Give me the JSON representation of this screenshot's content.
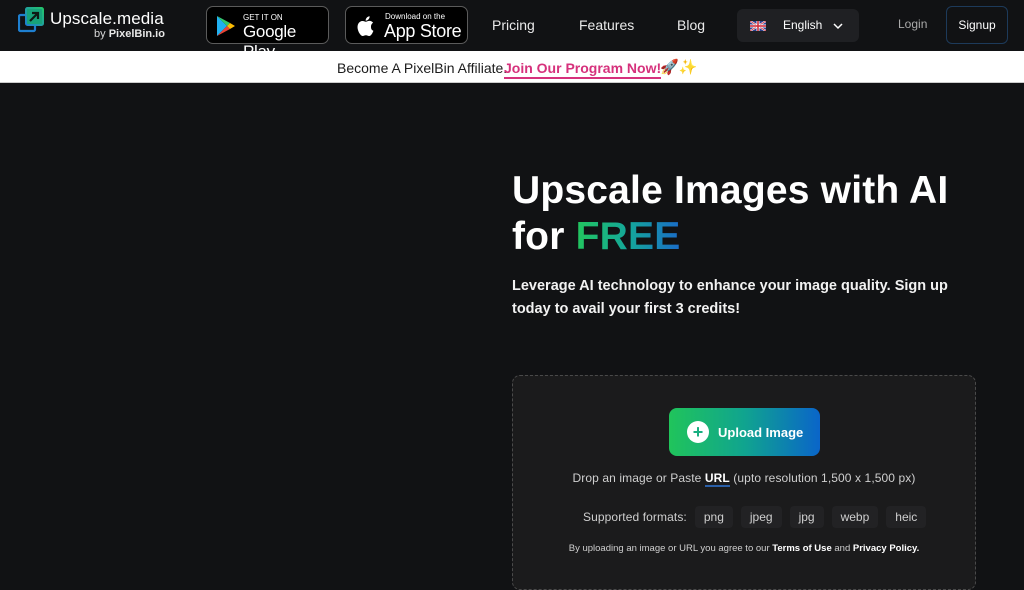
{
  "brand": {
    "name": "Upscale.media",
    "byline_prefix": "by",
    "byline_company": "PixelBin.io"
  },
  "stores": {
    "google_play": {
      "small": "GET IT ON",
      "big": "Google Play"
    },
    "app_store": {
      "small": "Download on the",
      "big": "App Store"
    }
  },
  "nav": {
    "links": [
      "Pricing",
      "Features",
      "Blog"
    ],
    "language": {
      "icon": "uk-flag-icon",
      "selected": "English"
    },
    "login": "Login",
    "signup": "Signup"
  },
  "banner": {
    "text": "Become A PixelBin Affiliate.",
    "cta": "Join Our Program Now!",
    "emoji": "🚀✨"
  },
  "hero": {
    "title_line1": "Upscale Images with AI",
    "title_line2_prefix": "for",
    "title_highlight": "FREE",
    "subtitle": "Leverage AI technology to enhance your image quality. Sign up today to avail your first 3 credits!"
  },
  "upload": {
    "button_label": "Upload Image",
    "hint_prefix": "Drop an image or Paste",
    "hint_url": "URL",
    "hint_suffix": "(upto resolution 1,500 x 1,500 px)",
    "formats_label": "Supported formats:",
    "formats": [
      "png",
      "jpeg",
      "jpg",
      "webp",
      "heic"
    ],
    "terms_prefix": "By uploading an image or URL you agree to our",
    "terms_link": "Terms of Use",
    "terms_and": "and",
    "privacy_link": "Privacy Policy."
  },
  "colors": {
    "background": "#111214",
    "accent_green": "#22c55e",
    "accent_blue": "#0a65c9",
    "affiliate_pink": "#d6317c"
  }
}
